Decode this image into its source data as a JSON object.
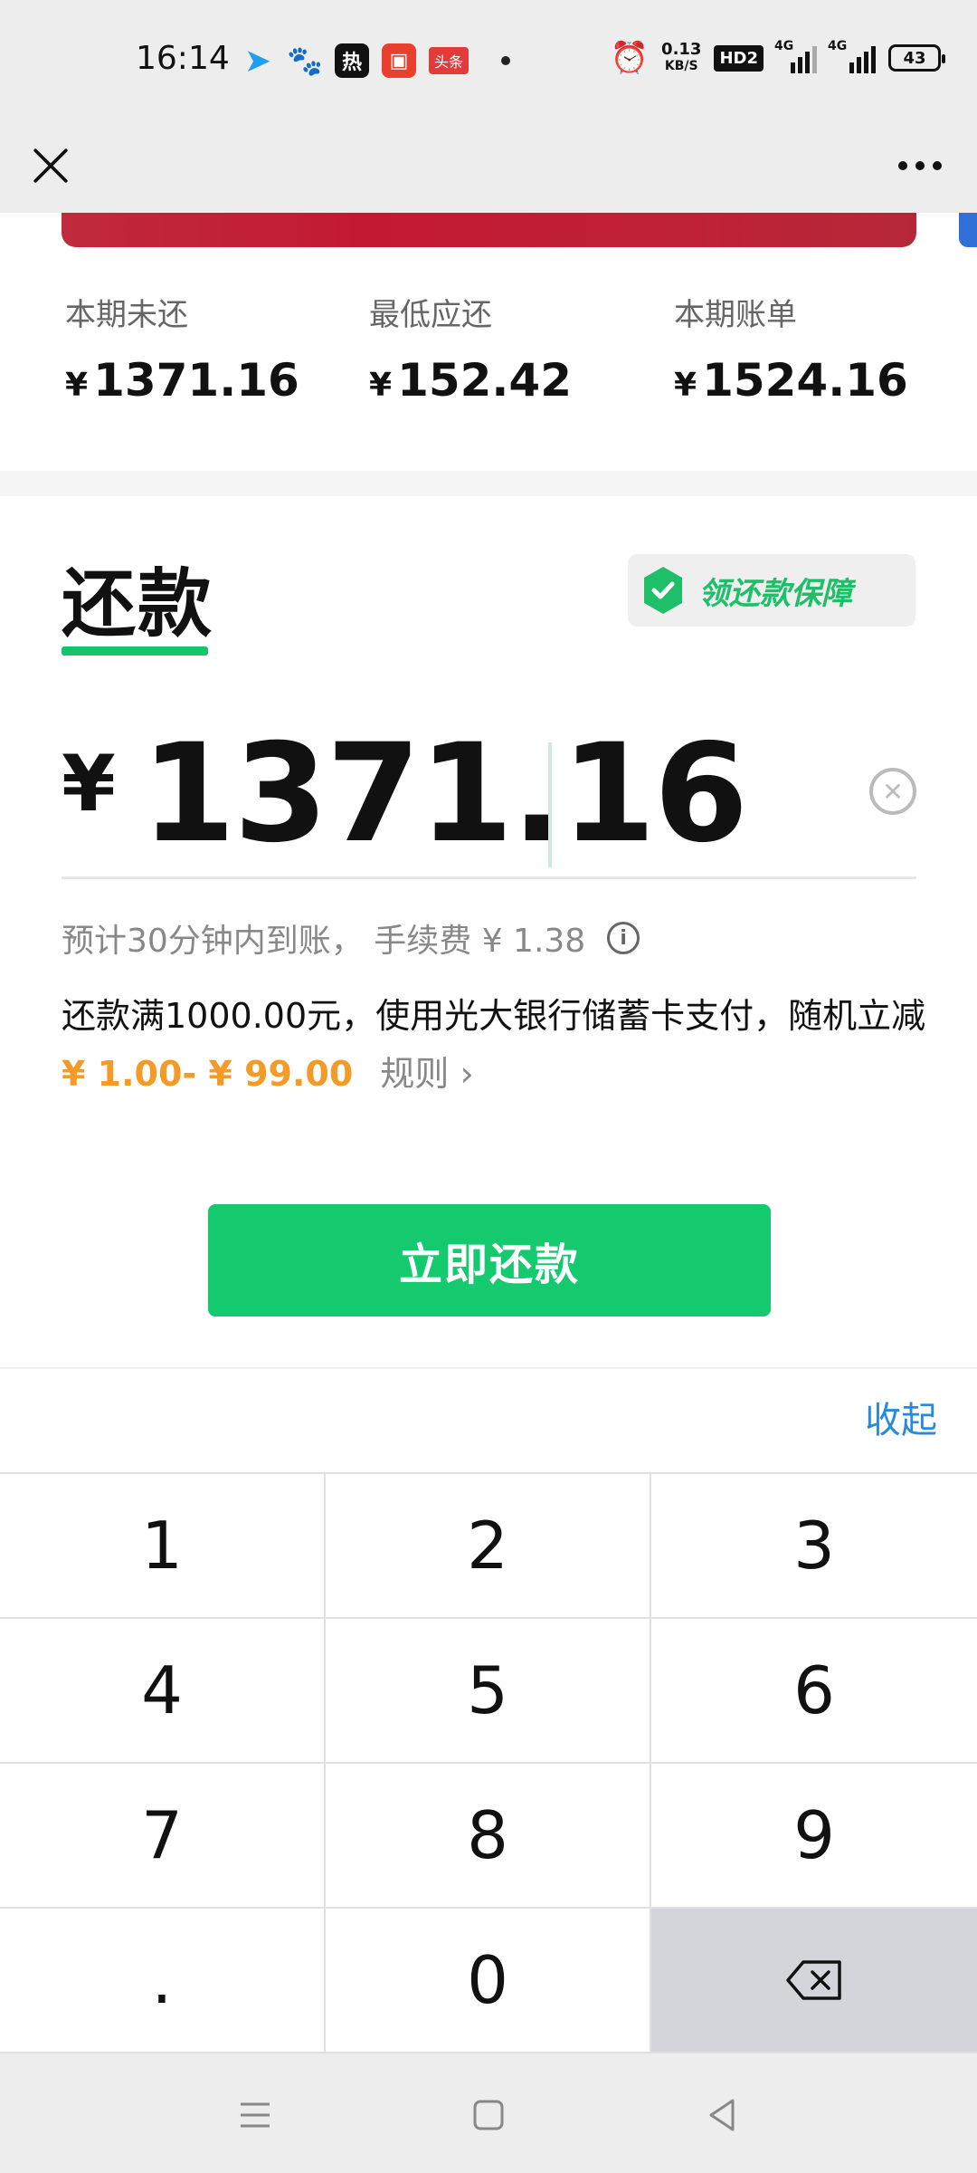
{
  "status_bar": {
    "time": "16:14",
    "net_speed_value": "0.13",
    "net_speed_unit": "KB/S",
    "hd_label": "HD2",
    "signal1_label": "4G",
    "signal2_label": "4G",
    "battery": "43",
    "hot_label": "热",
    "toutiao_label": "头条"
  },
  "summary": {
    "unpaid": {
      "label": "本期未还",
      "currency": "¥",
      "value": "1371.16"
    },
    "minimum": {
      "label": "最低应还",
      "currency": "¥",
      "value": "152.42"
    },
    "statement": {
      "label": "本期账单",
      "currency": "¥",
      "value": "1524.16"
    }
  },
  "repay": {
    "title": "还款",
    "guarantee_label": "领还款保障",
    "currency": "¥",
    "amount": "1371.16",
    "eta_text": "预计30分钟内到账， 手续费 ¥ 1.38",
    "promo_text": "还款满1000.00元，使用光大银行储蓄卡支付，随机立减",
    "promo_range": "¥ 1.00- ¥ 99.00",
    "rule_label": "规则",
    "submit_label": "立即还款"
  },
  "keyboard": {
    "collapse_label": "收起",
    "keys": [
      "1",
      "2",
      "3",
      "4",
      "5",
      "6",
      "7",
      "8",
      "9",
      ".",
      "0"
    ]
  },
  "colors": {
    "accent_green": "#14c96e",
    "promo_orange": "#f39a27",
    "link_blue": "#2a8ad9",
    "card_red": "#c31a32"
  }
}
